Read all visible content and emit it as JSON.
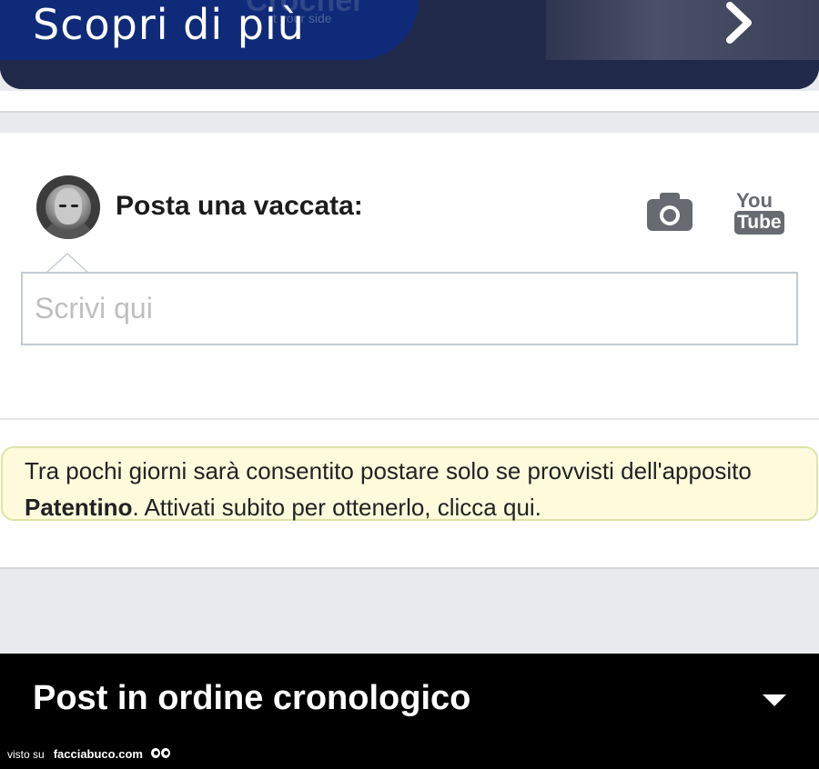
{
  "banner": {
    "title": "Scopri di più",
    "brand_partial": "Crocher",
    "tagline_partial": "t your side"
  },
  "composer": {
    "label": "Posta una vaccata:",
    "input_placeholder": "Scrivi qui",
    "input_value": "",
    "youtube_top": "You",
    "youtube_bottom": "Tube"
  },
  "notice": {
    "text_before": "Tra pochi giorni sarà consentito postare solo se provvisti dell'apposito ",
    "highlight": "Patentino",
    "text_after": ". Attivati subito per ottenerlo, clicca qui."
  },
  "sort": {
    "title": "Post in ordine cronologico"
  },
  "watermark": {
    "prefix": "visto su",
    "brand": "facciabuco.com"
  },
  "colors": {
    "banner_blue": "#0e2a78",
    "banner_dark": "#20294a",
    "notice_bg": "#fdfbdc",
    "notice_border": "#dfe3a6",
    "icon_gray": "#676a70"
  },
  "icons": [
    "chevron-right-icon",
    "camera-icon",
    "youtube-icon",
    "caret-down-icon",
    "eyes-icon"
  ]
}
